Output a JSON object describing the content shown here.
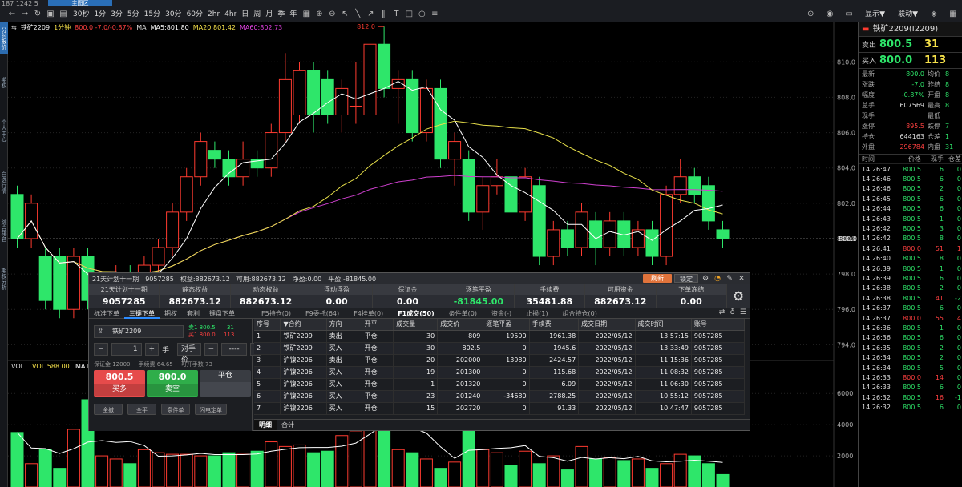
{
  "app": {
    "title": "187 1242 5",
    "tab": "主图区"
  },
  "toolbar": {
    "periods": [
      "30秒",
      "1分",
      "3分",
      "5分",
      "15分",
      "30分",
      "60分",
      "2hr",
      "4hr",
      "日",
      "周",
      "月",
      "季",
      "年"
    ],
    "right": {
      "link": "联动▼",
      "display": "显示▼"
    }
  },
  "sidebar": [
    "分时报价",
    "期权",
    "个人中心",
    "自选行情",
    "综合排名",
    "期权分析"
  ],
  "chart_info": {
    "symbol": "铁矿2209",
    "period": "1分钟",
    "quote": "800.0 -7.0/-0.87%",
    "ma_label": "MA",
    "ma5": "MA5:801.80",
    "ma20": "MA20:801.42",
    "ma60": "MA60:802.73",
    "vol_label": "VOL",
    "vol_value": "VOL:588.00",
    "vol_ma": "MA1:"
  },
  "chart_data": {
    "type": "candlestick",
    "y_ticks": [
      794.0,
      796.0,
      798.0,
      800.0,
      802.0,
      804.0,
      806.0,
      808.0,
      810.0
    ],
    "ylim": [
      793.2,
      811.6
    ],
    "volume_ticks": [
      2000,
      4000,
      6000
    ],
    "current_price": 800.0,
    "high_marker": 812.0,
    "candles": [
      {
        "o": 802.5,
        "c": 800.0,
        "h": 803.0,
        "l": 799.5
      },
      {
        "o": 800.0,
        "c": 802.0,
        "h": 802.5,
        "l": 799.5
      },
      {
        "o": 799.0,
        "c": 796.5,
        "h": 799.5,
        "l": 796.0
      },
      {
        "o": 799.0,
        "c": 796.0,
        "h": 799.5,
        "l": 795.5
      },
      {
        "o": 796.0,
        "c": 799.0,
        "h": 799.5,
        "l": 795.5
      },
      {
        "o": 799.0,
        "c": 796.5,
        "h": 799.5,
        "l": 796.0
      },
      {
        "o": 796.0,
        "c": 797.0,
        "h": 798.0,
        "l": 795.5
      },
      {
        "o": 797.0,
        "c": 798.0,
        "h": 798.5,
        "l": 796.5
      },
      {
        "o": 798.0,
        "c": 797.0,
        "h": 798.5,
        "l": 796.5
      },
      {
        "o": 797.0,
        "c": 798.5,
        "h": 799.0,
        "l": 796.5
      },
      {
        "o": 798.5,
        "c": 799.5,
        "h": 800.0,
        "l": 798.0
      },
      {
        "o": 799.5,
        "c": 801.5,
        "h": 802.0,
        "l": 799.0
      },
      {
        "o": 801.5,
        "c": 803.5,
        "h": 804.0,
        "l": 801.0
      },
      {
        "o": 803.5,
        "c": 805.5,
        "h": 806.0,
        "l": 803.0
      },
      {
        "o": 805.0,
        "c": 804.5,
        "h": 805.5,
        "l": 804.0
      },
      {
        "o": 804.5,
        "c": 803.5,
        "h": 805.0,
        "l": 803.0
      },
      {
        "o": 803.5,
        "c": 804.5,
        "h": 805.5,
        "l": 803.0
      },
      {
        "o": 804.5,
        "c": 804.0,
        "h": 805.0,
        "l": 803.5
      },
      {
        "o": 804.0,
        "c": 806.0,
        "h": 806.5,
        "l": 803.5
      },
      {
        "o": 806.0,
        "c": 809.0,
        "h": 810.5,
        "l": 805.5
      },
      {
        "o": 807.0,
        "c": 809.5,
        "h": 810.0,
        "l": 806.5
      },
      {
        "o": 809.5,
        "c": 807.0,
        "h": 810.0,
        "l": 806.0
      },
      {
        "o": 809.0,
        "c": 807.0,
        "h": 809.5,
        "l": 806.5
      },
      {
        "o": 807.0,
        "c": 808.5,
        "h": 809.0,
        "l": 806.0
      },
      {
        "o": 807.5,
        "c": 807.5,
        "h": 810.0,
        "l": 806.5
      },
      {
        "o": 807.0,
        "c": 811.0,
        "h": 811.5,
        "l": 806.5
      },
      {
        "o": 811.0,
        "c": 808.5,
        "h": 812.0,
        "l": 808.0
      },
      {
        "o": 808.5,
        "c": 809.0,
        "h": 809.5,
        "l": 806.5
      },
      {
        "o": 809.0,
        "c": 806.0,
        "h": 809.5,
        "l": 805.5
      },
      {
        "o": 806.0,
        "c": 808.5,
        "h": 809.0,
        "l": 805.5
      },
      {
        "o": 808.5,
        "c": 804.5,
        "h": 809.0,
        "l": 804.0
      },
      {
        "o": 804.5,
        "c": 805.5,
        "h": 806.0,
        "l": 803.0
      },
      {
        "o": 804.5,
        "c": 801.5,
        "h": 805.0,
        "l": 801.0
      },
      {
        "o": 801.5,
        "c": 803.0,
        "h": 803.5,
        "l": 800.5
      },
      {
        "o": 803.0,
        "c": 803.5,
        "h": 804.5,
        "l": 802.5
      },
      {
        "o": 803.5,
        "c": 801.5,
        "h": 804.0,
        "l": 801.0
      },
      {
        "o": 801.5,
        "c": 803.5,
        "h": 804.0,
        "l": 801.0
      },
      {
        "o": 803.0,
        "c": 799.0,
        "h": 803.5,
        "l": 798.5
      },
      {
        "o": 799.0,
        "c": 800.5,
        "h": 801.0,
        "l": 798.5
      },
      {
        "o": 800.5,
        "c": 799.5,
        "h": 801.0,
        "l": 799.0
      },
      {
        "o": 799.5,
        "c": 801.5,
        "h": 802.0,
        "l": 799.0
      },
      {
        "o": 801.0,
        "c": 799.5,
        "h": 801.5,
        "l": 798.5
      },
      {
        "o": 799.5,
        "c": 801.0,
        "h": 801.5,
        "l": 799.0
      },
      {
        "o": 801.0,
        "c": 799.5,
        "h": 801.5,
        "l": 799.0
      },
      {
        "o": 799.5,
        "c": 800.5,
        "h": 801.0,
        "l": 799.0
      },
      {
        "o": 800.5,
        "c": 799.0,
        "h": 801.0,
        "l": 798.5
      },
      {
        "o": 799.0,
        "c": 802.5,
        "h": 803.0,
        "l": 798.5
      },
      {
        "o": 802.5,
        "c": 803.5,
        "h": 804.5,
        "l": 802.0
      },
      {
        "o": 803.5,
        "c": 802.5,
        "h": 804.0,
        "l": 802.0
      },
      {
        "o": 803.0,
        "c": 801.0,
        "h": 803.5,
        "l": 800.5
      },
      {
        "o": 800.5,
        "c": 800.0,
        "h": 801.0,
        "l": 799.5
      }
    ],
    "volumes": [
      3500,
      1500,
      2400,
      1200,
      3700,
      5600,
      2000,
      1800,
      1500,
      2400,
      2200,
      2100,
      2100,
      2000,
      2000,
      2200,
      2100,
      2300,
      2900,
      2600,
      2700,
      2200,
      2300,
      3300,
      3600,
      5600,
      5300,
      2400,
      2200,
      1800,
      1200,
      1600,
      5000,
      2400,
      2200,
      1400,
      2300,
      1500,
      2000,
      1100,
      2600,
      1800,
      1900,
      1700,
      1800,
      1200,
      1500,
      2100,
      2000,
      1500,
      800
    ]
  },
  "orderbook": {
    "title": "铁矿2209(I2209)",
    "ask": {
      "label": "卖出",
      "price": "800.5",
      "qty": "31"
    },
    "bid": {
      "label": "买入",
      "price": "800.0",
      "qty": "113"
    },
    "stats": [
      {
        "k": "最新",
        "v": "800.0",
        "k2": "均价",
        "v2": "8"
      },
      {
        "k": "涨跌",
        "v": "-7.0",
        "k2": "昨结",
        "v2": "8"
      },
      {
        "k": "幅度",
        "v": "-0.87%",
        "k2": "开盘",
        "v2": "8"
      },
      {
        "k": "总手",
        "v": "607569",
        "k2": "最高",
        "v2": "8"
      },
      {
        "k": "现手",
        "v": "",
        "k2": "最低",
        "v2": ""
      },
      {
        "k": "涨停",
        "v": "895.5",
        "k2": "跌停",
        "v2": "7"
      },
      {
        "k": "持仓",
        "v": "644163",
        "k2": "仓差",
        "v2": "1"
      },
      {
        "k": "外盘",
        "v": "296784",
        "k2": "内盘",
        "v2": "31"
      }
    ],
    "tick_header": [
      "时间",
      "价格",
      "现手",
      "仓差"
    ],
    "ticks": [
      {
        "t": "14:26:47",
        "p": "800.5",
        "q": "6",
        "d": "0"
      },
      {
        "t": "14:26:46",
        "p": "800.5",
        "q": "6",
        "d": "0"
      },
      {
        "t": "14:26:46",
        "p": "800.5",
        "q": "2",
        "d": "0"
      },
      {
        "t": "14:26:45",
        "p": "800.5",
        "q": "6",
        "d": "0"
      },
      {
        "t": "14:26:44",
        "p": "800.5",
        "q": "6",
        "d": "0"
      },
      {
        "t": "14:26:43",
        "p": "800.5",
        "q": "1",
        "d": "0"
      },
      {
        "t": "14:26:42",
        "p": "800.5",
        "q": "3",
        "d": "0"
      },
      {
        "t": "14:26:42",
        "p": "800.5",
        "q": "8",
        "d": "0"
      },
      {
        "t": "14:26:41",
        "p": "800.0",
        "q": "51",
        "d": "1"
      },
      {
        "t": "14:26:40",
        "p": "800.5",
        "q": "8",
        "d": "0"
      },
      {
        "t": "14:26:39",
        "p": "800.5",
        "q": "1",
        "d": "0"
      },
      {
        "t": "14:26:39",
        "p": "800.5",
        "q": "6",
        "d": "0"
      },
      {
        "t": "14:26:38",
        "p": "800.5",
        "q": "2",
        "d": "0"
      },
      {
        "t": "14:26:38",
        "p": "800.5",
        "q": "41",
        "d": "-2"
      },
      {
        "t": "14:26:37",
        "p": "800.5",
        "q": "6",
        "d": "0"
      },
      {
        "t": "14:26:37",
        "p": "800.0",
        "q": "55",
        "d": "4"
      },
      {
        "t": "14:26:36",
        "p": "800.5",
        "q": "1",
        "d": "0"
      },
      {
        "t": "14:26:36",
        "p": "800.5",
        "q": "6",
        "d": "0"
      },
      {
        "t": "14:26:35",
        "p": "800.5",
        "q": "2",
        "d": "0"
      },
      {
        "t": "14:26:34",
        "p": "800.5",
        "q": "2",
        "d": "0"
      },
      {
        "t": "14:26:34",
        "p": "800.5",
        "q": "5",
        "d": "0"
      },
      {
        "t": "14:26:33",
        "p": "800.0",
        "q": "14",
        "d": "0"
      },
      {
        "t": "14:26:33",
        "p": "800.5",
        "q": "6",
        "d": "0"
      },
      {
        "t": "14:26:32",
        "p": "800.5",
        "q": "16",
        "d": "-1"
      },
      {
        "t": "14:26:32",
        "p": "800.5",
        "q": "6",
        "d": "0"
      }
    ]
  },
  "tradepanel": {
    "titlebar": {
      "account_name": "21天计划十一期",
      "account_id": "9057285",
      "equity": "权益:882673.12",
      "available": "可用:882673.12",
      "net_value": "净盈:0.00",
      "close_pnl": "平盈:-81845.00",
      "refresh": "刷新",
      "lock": "锁定"
    },
    "account": [
      {
        "h": "21天计划十一期",
        "v": "9057285"
      },
      {
        "h": "静态权益",
        "v": "882673.12"
      },
      {
        "h": "动态权益",
        "v": "882673.12"
      },
      {
        "h": "浮动浮盈",
        "v": "0.00"
      },
      {
        "h": "保证金",
        "v": "0.00"
      },
      {
        "h": "逐笔平盈",
        "v": "-81845.00",
        "color": "green"
      },
      {
        "h": "手续费",
        "v": "35481.88"
      },
      {
        "h": "可用资金",
        "v": "882673.12"
      },
      {
        "h": "下单冻结",
        "v": "0.00"
      }
    ],
    "tabs": [
      "标准下单",
      "三键下单",
      "期权",
      "套利",
      "键盘下单"
    ],
    "active_tab": 1,
    "order": {
      "symbol": "铁矿2209",
      "sell_quote": "卖1 800.5",
      "sell_qty": "31",
      "buy_quote": "买1 800.0",
      "buy_qty": "113",
      "qty": "1",
      "qty_unit": "手",
      "price_type": "对手价",
      "price": "----",
      "margin": "保证金 12000",
      "fee": "手续费 64.65",
      "openable": "可开手数 73",
      "buy_price": "800.5",
      "buy_label": "买多",
      "sell_price": "800.0",
      "sell_label": "卖空",
      "close_label": "平仓",
      "small_buttons": [
        "全撤",
        "全平",
        "条件单",
        "闪电定单"
      ]
    },
    "subtabs": [
      "F5持仓(0)",
      "F9委托(64)",
      "F4挂单(0)",
      "F1成交(50)",
      "条件单(0)",
      "资金(-)",
      "止损(1)",
      "组合持仓(0)"
    ],
    "active_subtab": 3,
    "columns": [
      "序号",
      "▼合约",
      "方向",
      "开平",
      "成交量",
      "成交价",
      "逐笔平盈",
      "手续费",
      "成交日期",
      "成交时间",
      "账号"
    ],
    "rows": [
      {
        "n": "1",
        "sym": "铁矿2209",
        "dir": "卖出",
        "oc": "平仓",
        "vol": "30",
        "px": "809",
        "pnl": "19500",
        "fee": "1961.38",
        "date": "2022/05/12",
        "time": "13:57:15",
        "acct": "9057285"
      },
      {
        "n": "2",
        "sym": "铁矿2209",
        "dir": "买入",
        "oc": "开仓",
        "vol": "30",
        "px": "802.5",
        "pnl": "0",
        "fee": "1945.6",
        "date": "2022/05/12",
        "time": "13:33:49",
        "acct": "9057285"
      },
      {
        "n": "3",
        "sym": "沪镍2206",
        "dir": "卖出",
        "oc": "平仓",
        "vol": "20",
        "px": "202000",
        "pnl": "13980",
        "fee": "2424.57",
        "date": "2022/05/12",
        "time": "11:15:36",
        "acct": "9057285"
      },
      {
        "n": "4",
        "sym": "沪镍2206",
        "dir": "买入",
        "oc": "开仓",
        "vol": "19",
        "px": "201300",
        "pnl": "0",
        "fee": "115.68",
        "date": "2022/05/12",
        "time": "11:08:32",
        "acct": "9057285"
      },
      {
        "n": "5",
        "sym": "沪镍2206",
        "dir": "买入",
        "oc": "开仓",
        "vol": "1",
        "px": "201320",
        "pnl": "0",
        "fee": "6.09",
        "date": "2022/05/12",
        "time": "11:06:30",
        "acct": "9057285"
      },
      {
        "n": "6",
        "sym": "沪镍2206",
        "dir": "买入",
        "oc": "平仓",
        "vol": "23",
        "px": "201240",
        "pnl": "-34680",
        "fee": "2788.25",
        "date": "2022/05/12",
        "time": "10:55:12",
        "acct": "9057285"
      },
      {
        "n": "7",
        "sym": "沪镍2206",
        "dir": "买入",
        "oc": "开仓",
        "vol": "15",
        "px": "202720",
        "pnl": "0",
        "fee": "91.33",
        "date": "2022/05/12",
        "time": "10:47:47",
        "acct": "9057285"
      }
    ],
    "bottom_tabs": [
      "明细",
      "合计"
    ]
  }
}
